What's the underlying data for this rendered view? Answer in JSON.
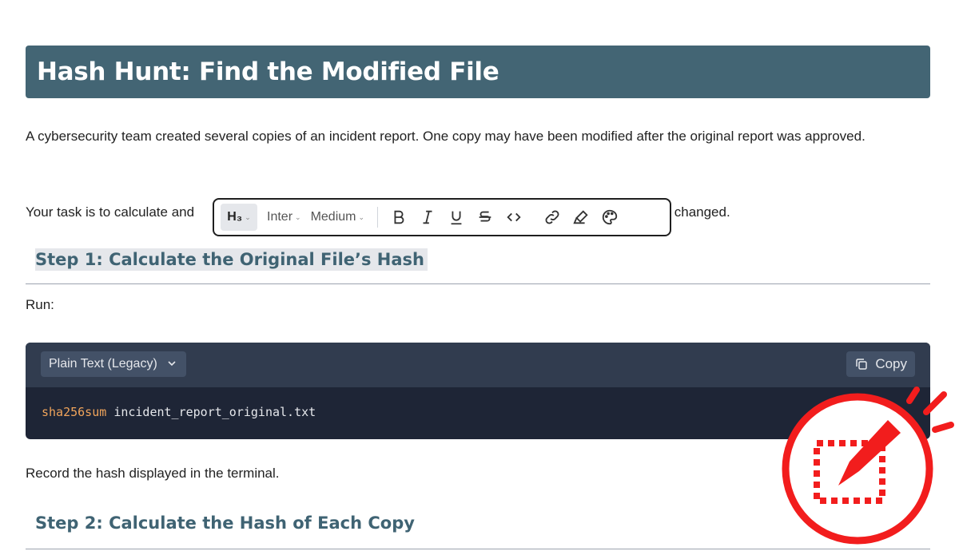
{
  "title": "Hash Hunt: Find the Modified File",
  "intro": "A cybersecurity team created several copies of an incident report. One copy may have been modified after the original report was approved.",
  "task_prefix": "Your task is to calculate and",
  "task_suffix": "as changed.",
  "toolbar": {
    "heading_level": "H₃",
    "font": "Inter",
    "weight": "Medium",
    "icons": [
      "bold-icon",
      "italic-icon",
      "underline-icon",
      "strikethrough-icon",
      "code-icon",
      "link-icon",
      "highlight-icon",
      "palette-icon"
    ]
  },
  "step1_heading": "Step 1: Calculate the Original File’s Hash",
  "run_label": "Run:",
  "code": {
    "language": "Plain Text (Legacy)",
    "copy_label": "Copy",
    "command": "sha256sum",
    "argument": "incident_report_original.txt"
  },
  "record_text": "Record the hash displayed in the terminal.",
  "step2_heading": "Step 2: Calculate the Hash of Each Copy",
  "colors": {
    "banner": "#436574",
    "heading": "#3f6373",
    "code_bg": "#1e2536",
    "code_header": "#313c4f",
    "badge_red": "#f21d1d"
  }
}
